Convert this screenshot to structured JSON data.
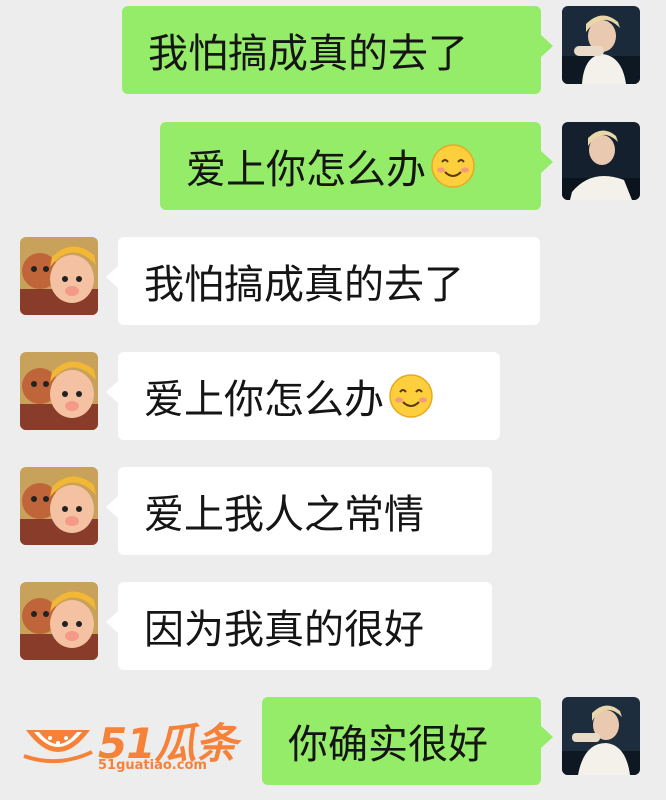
{
  "chat": {
    "messages": [
      {
        "side": "me",
        "text": "我怕搞成真的去了",
        "emoji": null
      },
      {
        "side": "me",
        "text": "爱上你怎么办",
        "emoji": "smile-emoji"
      },
      {
        "side": "them",
        "text": "我怕搞成真的去了",
        "emoji": null
      },
      {
        "side": "them",
        "text": "爱上你怎么办",
        "emoji": "smile-emoji"
      },
      {
        "side": "them",
        "text": "爱上我人之常情",
        "emoji": null
      },
      {
        "side": "them",
        "text": "因为我真的很好",
        "emoji": null
      },
      {
        "side": "me",
        "text": "你确实很好",
        "emoji": null
      }
    ]
  },
  "watermark": {
    "brand": "51瓜条",
    "url": "51guatiao.com"
  },
  "colors": {
    "background": "#ededed",
    "my_bubble": "#95ec69",
    "their_bubble": "#ffffff",
    "watermark": "#f6823a"
  }
}
